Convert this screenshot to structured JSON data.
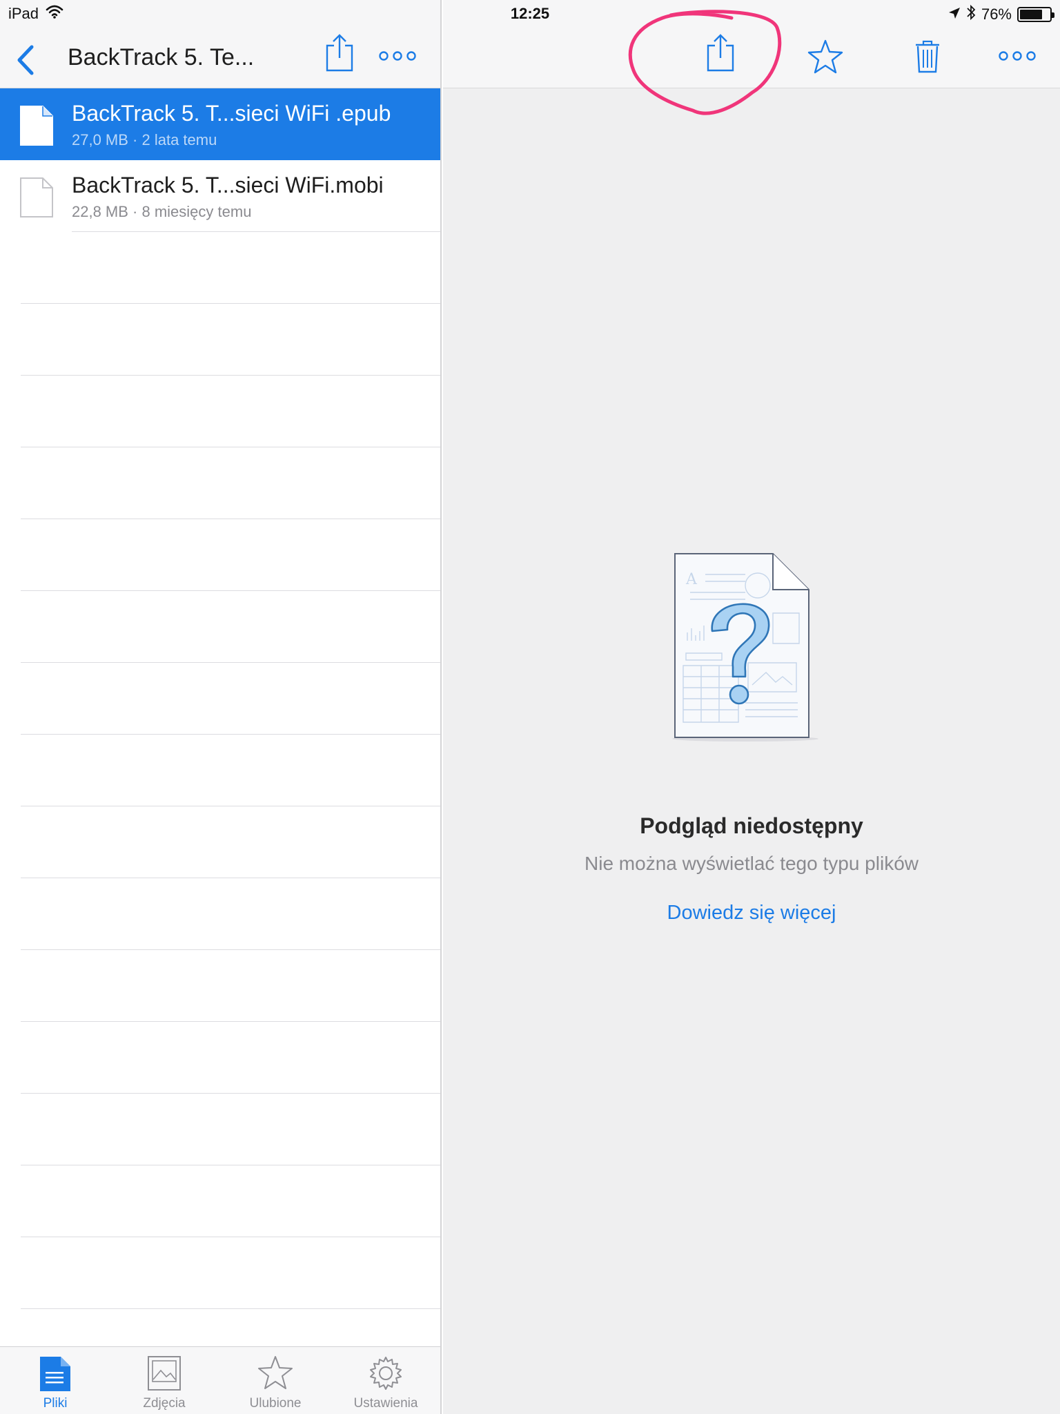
{
  "status_bar": {
    "device": "iPad",
    "time": "12:25",
    "battery_percent": "76%",
    "battery_level": 0.76,
    "icons": [
      "wifi-icon",
      "location-arrow-icon",
      "bluetooth-icon",
      "battery-icon"
    ]
  },
  "left_pane": {
    "title": "BackTrack 5. Te...",
    "files": [
      {
        "name": "BackTrack 5. T...sieci WiFi .epub",
        "meta": "27,0 MB · 2 lata temu",
        "selected": true
      },
      {
        "name": "BackTrack 5. T...sieci WiFi.mobi",
        "meta": "22,8 MB · 8 miesięcy temu",
        "selected": false
      }
    ],
    "tabs": [
      {
        "label": "Pliki",
        "icon": "document-icon",
        "active": true
      },
      {
        "label": "Zdjęcia",
        "icon": "photo-icon",
        "active": false
      },
      {
        "label": "Ulubione",
        "icon": "star-icon",
        "active": false
      },
      {
        "label": "Ustawienia",
        "icon": "gear-icon",
        "active": false
      }
    ]
  },
  "right_pane": {
    "toolbar_icons": [
      "share-icon",
      "star-icon",
      "trash-icon",
      "more-icon"
    ],
    "preview": {
      "title": "Podgląd niedostępny",
      "subtitle": "Nie można wyświetlać tego typu plików",
      "link": "Dowiedz się więcej"
    }
  },
  "colors": {
    "accent": "#1c7ce6",
    "annotation": "#f0357a",
    "pane_background": "#efeff0"
  }
}
